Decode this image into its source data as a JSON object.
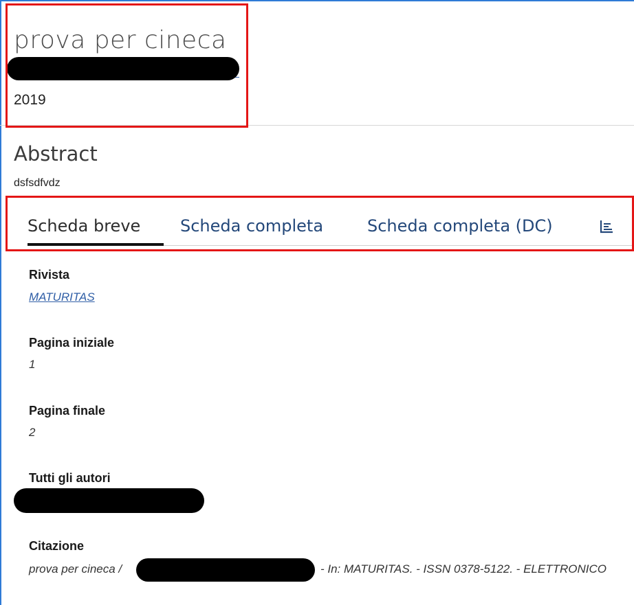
{
  "header": {
    "title": "prova per cineca",
    "year": "2019"
  },
  "abstract": {
    "heading": "Abstract",
    "text": "dsfsdfvdz"
  },
  "tabs": [
    {
      "label": "Scheda breve",
      "active": true
    },
    {
      "label": "Scheda completa",
      "active": false
    },
    {
      "label": "Scheda completa (DC)",
      "active": false
    }
  ],
  "tabs_icon": "bar-chart-icon",
  "fields": {
    "rivista": {
      "label": "Rivista",
      "value": "MATURITAS"
    },
    "pagina_iniziale": {
      "label": "Pagina iniziale",
      "value": "1"
    },
    "pagina_finale": {
      "label": "Pagina finale",
      "value": "2"
    },
    "tutti_autori": {
      "label": "Tutti gli autori"
    },
    "citazione": {
      "label": "Citazione",
      "before": "prova per cineca /",
      "after": "- In: MATURITAS. - ISSN 0378-5122. - ELETTRONICO"
    }
  },
  "colors": {
    "highlight": "#e41616",
    "link": "#2f5ea6",
    "tab_inactive": "#24487a",
    "frame": "#2f7bd6"
  }
}
